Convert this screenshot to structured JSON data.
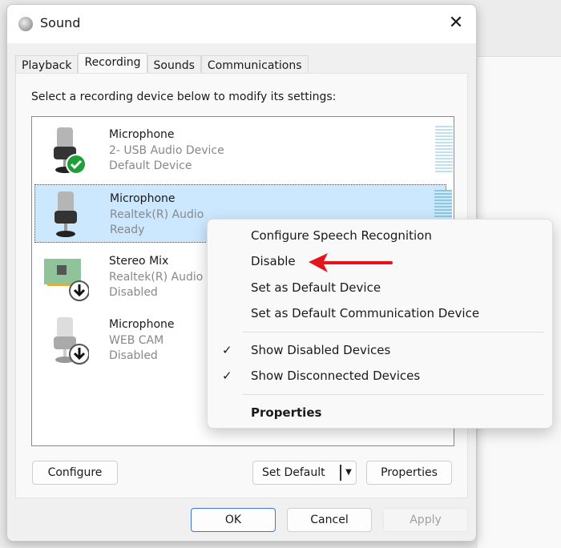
{
  "window": {
    "title": "Sound",
    "close": "✕"
  },
  "tabs": [
    {
      "label": "Playback"
    },
    {
      "label": "Recording"
    },
    {
      "label": "Sounds"
    },
    {
      "label": "Communications"
    }
  ],
  "instruction": "Select a recording device below to modify its settings:",
  "devices": [
    {
      "name": "Microphone",
      "device": "2- USB Audio Device",
      "status": "Default Device",
      "icon": "microphone-icon",
      "badge": "check-badge-icon"
    },
    {
      "name": "Microphone",
      "device": "Realtek(R) Audio",
      "status": "Ready",
      "icon": "microphone-icon"
    },
    {
      "name": "Stereo Mix",
      "device": "Realtek(R) Audio",
      "status": "Disabled",
      "icon": "sound-card-icon",
      "badge": "down-arrow-badge-icon"
    },
    {
      "name": "Microphone",
      "device": "WEB CAM",
      "status": "Disabled",
      "icon": "microphone-icon",
      "badge": "down-arrow-badge-icon"
    }
  ],
  "buttons": {
    "configure": "Configure",
    "set_default": "Set Default",
    "properties": "Properties",
    "ok": "OK",
    "cancel": "Cancel",
    "apply": "Apply"
  },
  "context_menu": {
    "items": [
      "Configure Speech Recognition",
      "Disable",
      "Set as Default Device",
      "Set as Default Communication Device"
    ],
    "checked": [
      "Show Disabled Devices",
      "Show Disconnected Devices"
    ],
    "properties": "Properties",
    "check": "✓"
  },
  "colors": {
    "selection": "#cce8ff",
    "annotation_arrow": "#e8141c",
    "default_badge": "#1f9e3a"
  }
}
